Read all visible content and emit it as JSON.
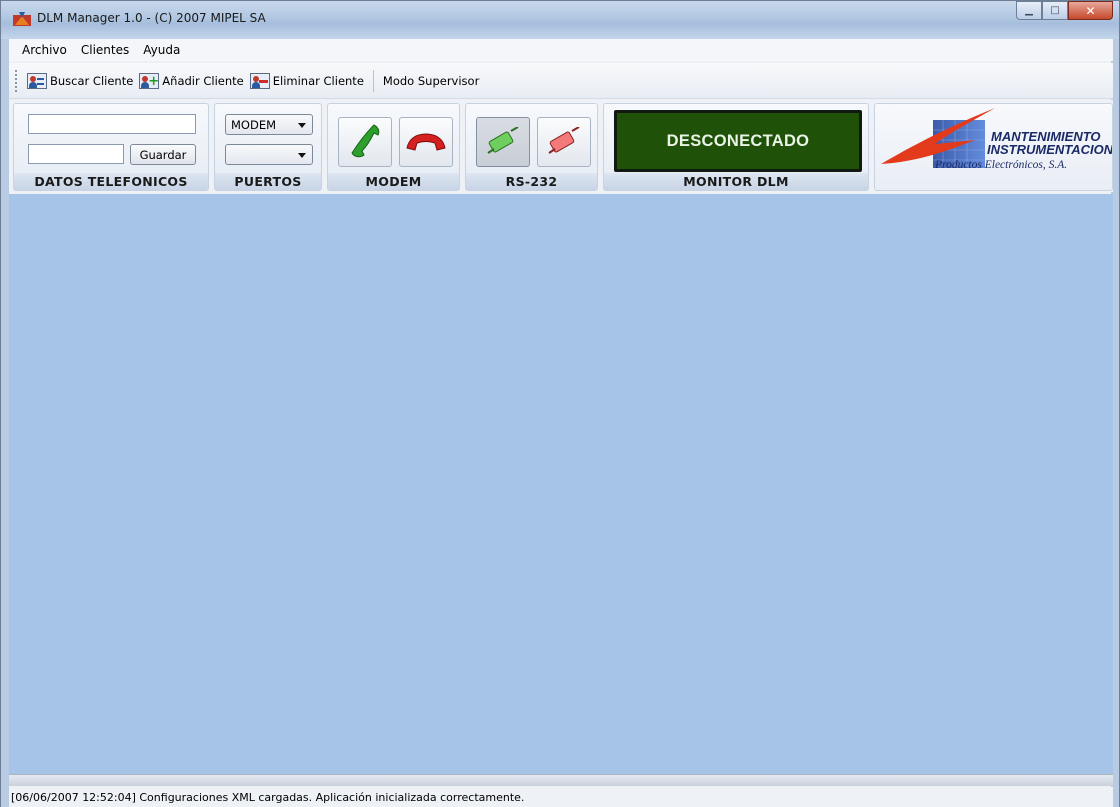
{
  "window": {
    "title": "DLM Manager 1.0 - (C) 2007 MIPEL SA"
  },
  "menu": {
    "items": [
      "Archivo",
      "Clientes",
      "Ayuda"
    ]
  },
  "toolbar": {
    "buscar_label": "Buscar Cliente",
    "anadir_label": "Añadir Cliente",
    "eliminar_label": "Eliminar Cliente",
    "supervisor_label": "Modo Supervisor"
  },
  "datos_telefonicos": {
    "label": "DATOS TELEFONICOS",
    "phone_value": "",
    "name_value": "",
    "guardar_label": "Guardar"
  },
  "puertos": {
    "label": "PUERTOS",
    "port_selected": "MODEM",
    "com_selected": ""
  },
  "modem": {
    "label": "MODEM"
  },
  "rs232": {
    "label": "RS-232"
  },
  "monitor": {
    "label": "MONITOR DLM",
    "status": "DESCONECTADO",
    "status_color": "#1f5208"
  },
  "logo": {
    "line1": "MANTENIMIENTO",
    "line2": "INSTRUMENTACION",
    "line3": "Productos Electrónicos, S.A."
  },
  "statusbar": {
    "text": "[06/06/2007 12:52:04] Configuraciones XML cargadas. Aplicación inicializada correctamente."
  },
  "colors": {
    "workspace": "#a6c3e8",
    "accent": "#2c5aa0"
  }
}
